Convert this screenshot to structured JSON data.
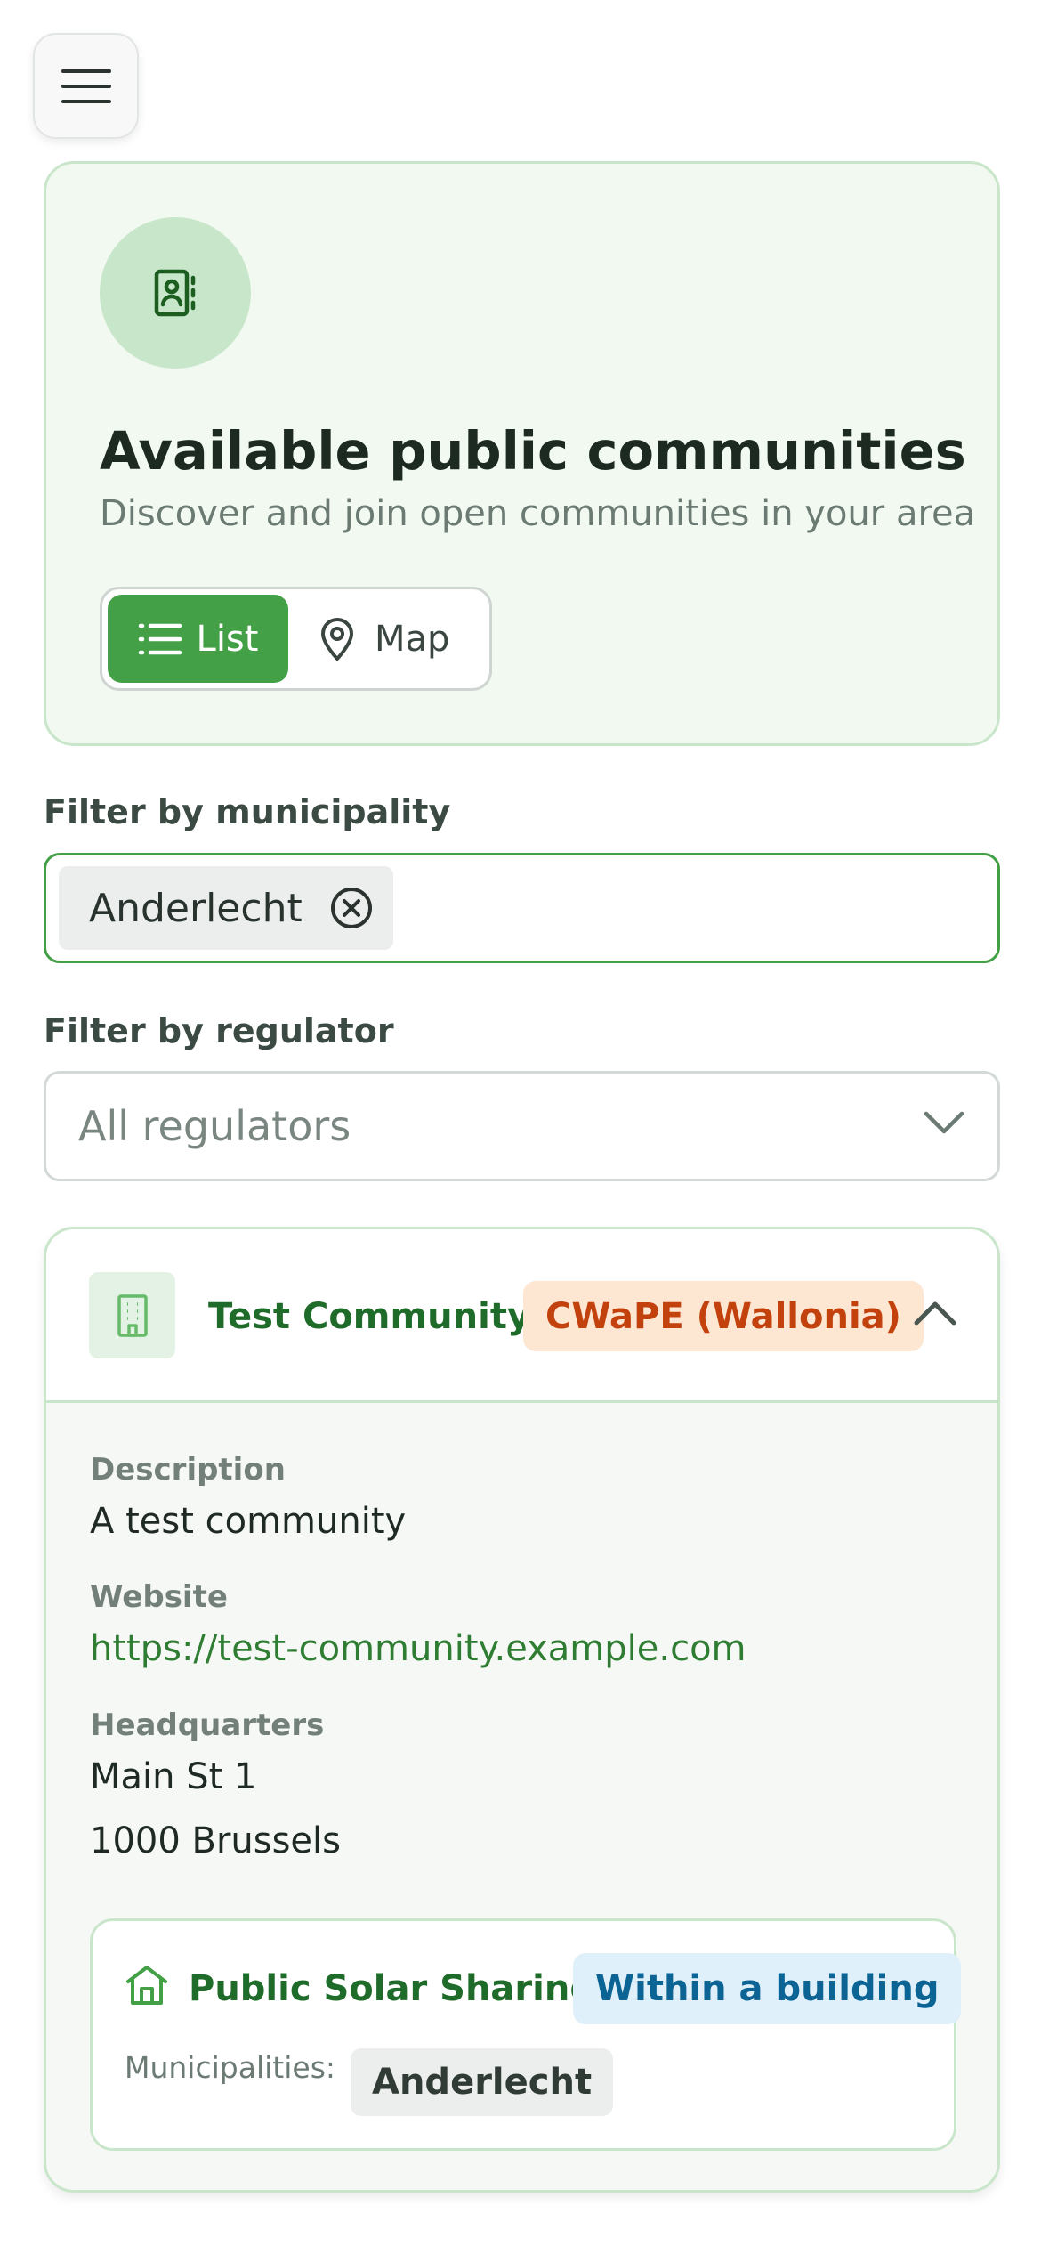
{
  "header": {
    "menu_icon": "hamburger-menu-icon"
  },
  "hero": {
    "icon": "contacts-book-icon",
    "title": "Available public communities",
    "subtitle": "Discover and join open communities in your area",
    "view_toggle": {
      "list_label": "List",
      "map_label": "Map",
      "selected": "List"
    }
  },
  "filters": {
    "municipality_label": "Filter by municipality",
    "municipality_selected": [
      "Anderlecht"
    ],
    "regulator_label": "Filter by regulator",
    "regulator_value": "All regulators"
  },
  "community": {
    "name": "Test Community",
    "regulator_badge": "CWaPE (Wallonia)",
    "expanded": true,
    "description_label": "Description",
    "description": "A test community",
    "website_label": "Website",
    "website": "https://test-community.example.com",
    "hq_label": "Headquarters",
    "hq_line1": "Main St 1",
    "hq_line2": "1000 Brussels",
    "program": {
      "name": "Public Solar Sharing",
      "scope_badge": "Within a building",
      "municipalities_label": "Municipalities:",
      "municipalities": [
        "Anderlecht"
      ]
    }
  },
  "colors": {
    "accent": "#43a047",
    "card_border": "#c9e6cb",
    "regulator_badge_bg": "#fde7d3",
    "regulator_badge_fg": "#c2410c",
    "scope_badge_bg": "#e0f0fb",
    "scope_badge_fg": "#0b6494"
  }
}
